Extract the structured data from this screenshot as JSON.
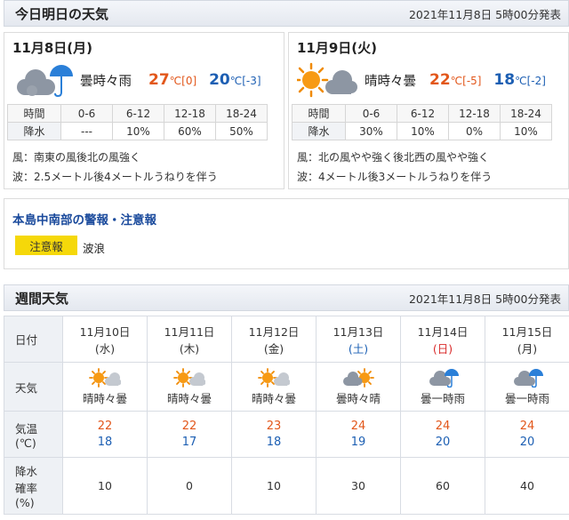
{
  "today": {
    "title": "今日明日の天気",
    "published": "2021年11月8日 5時00分発表",
    "days": [
      {
        "date": "11月8日(月)",
        "icon": "cloud-rain-icon",
        "weather": "曇時々雨",
        "high": "27",
        "high_diff": "[0]",
        "low": "20",
        "low_diff": "[-3]",
        "unit": "℃",
        "rain_header": [
          "時間",
          "0-6",
          "6-12",
          "12-18",
          "18-24"
        ],
        "rain_row": [
          "降水",
          "---",
          "10%",
          "60%",
          "50%"
        ],
        "wind": "風：南東の風後北の風強く",
        "wave": "波：2.5メートル後4メートルうねりを伴う"
      },
      {
        "date": "11月9日(火)",
        "icon": "sun-cloud-icon",
        "weather": "晴時々曇",
        "high": "22",
        "high_diff": "[-5]",
        "low": "18",
        "low_diff": "[-2]",
        "unit": "℃",
        "rain_header": [
          "時間",
          "0-6",
          "6-12",
          "12-18",
          "18-24"
        ],
        "rain_row": [
          "降水",
          "30%",
          "10%",
          "0%",
          "10%"
        ],
        "wind": "風：北の風やや強く後北西の風やや強く",
        "wave": "波：4メートル後3メートルうねりを伴う"
      }
    ]
  },
  "warning": {
    "title": "本島中南部の警報・注意報",
    "badge": "注意報",
    "text": "波浪"
  },
  "weekly": {
    "title": "週間天気",
    "published": "2021年11月8日 5時00分発表",
    "labels": {
      "date": "日付",
      "weather": "天気",
      "temp_1": "気温",
      "temp_2": "(℃)",
      "rain_1": "降水",
      "rain_2": "確率",
      "rain_3": "(%)"
    },
    "days": [
      {
        "date": "11月10日",
        "dow": "(水)",
        "icon": "sun-cloud-icon",
        "weather": "晴時々曇",
        "high": "22",
        "low": "18",
        "rain": "10"
      },
      {
        "date": "11月11日",
        "dow": "(木)",
        "icon": "sun-cloud-icon",
        "weather": "晴時々曇",
        "high": "22",
        "low": "17",
        "rain": "0"
      },
      {
        "date": "11月12日",
        "dow": "(金)",
        "icon": "sun-cloud-icon",
        "weather": "晴時々曇",
        "high": "23",
        "low": "18",
        "rain": "10"
      },
      {
        "date": "11月13日",
        "dow": "(土)",
        "icon": "cloud-sun-icon",
        "weather": "曇時々晴",
        "high": "24",
        "low": "19",
        "rain": "30"
      },
      {
        "date": "11月14日",
        "dow": "(日)",
        "icon": "cloud-rain-icon",
        "weather": "曇一時雨",
        "high": "24",
        "low": "20",
        "rain": "60"
      },
      {
        "date": "11月15日",
        "dow": "(月)",
        "icon": "cloud-rain-icon",
        "weather": "曇一時雨",
        "high": "24",
        "low": "20",
        "rain": "40"
      }
    ]
  },
  "colors": {
    "high_temp": "#e2571b",
    "low_temp": "#1d5fb3",
    "warning_badge": "#f5d80a",
    "warning_title": "#1a4a9c",
    "saturday": "#1a5fb4",
    "sunday": "#d92b2b"
  }
}
